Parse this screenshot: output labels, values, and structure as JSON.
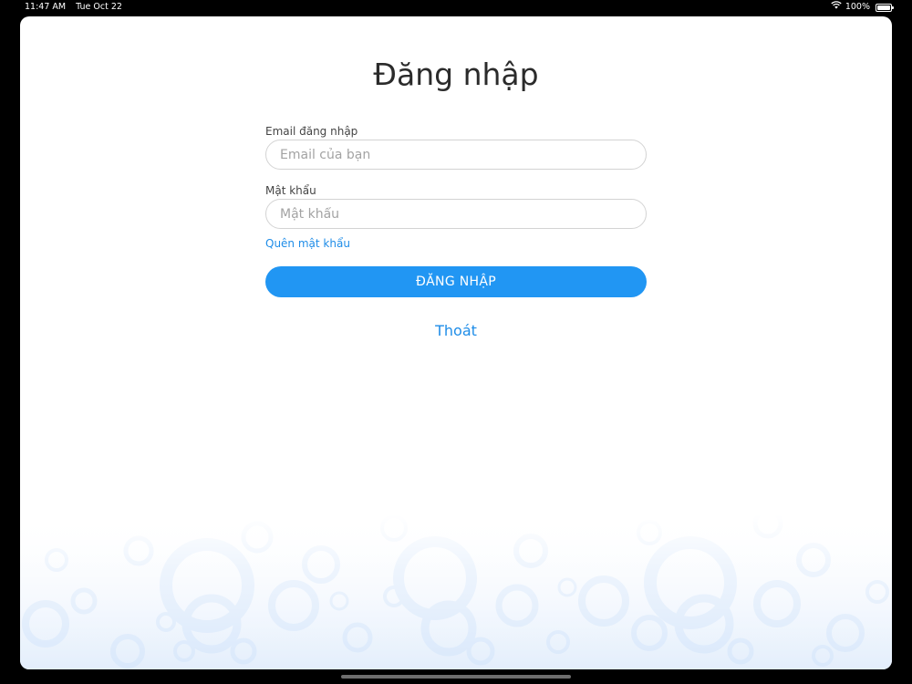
{
  "status_bar": {
    "time": "11:47 AM",
    "date": "Tue Oct 22",
    "battery": "100%",
    "battery_level": 1.0
  },
  "login": {
    "title": "Đăng nhập",
    "email_label": "Email đăng nhập",
    "email_placeholder": "Email của bạn",
    "email_value": "",
    "password_label": "Mật khẩu",
    "password_placeholder": "Mật khẩu",
    "password_value": "",
    "forgot_password": "Quên mật khẩu",
    "login_button": "ĐĂNG NHẬP",
    "exit_link": "Thoát"
  },
  "colors": {
    "accent": "#2196f3",
    "link": "#1f8de8",
    "pattern": "#d9e8fb"
  },
  "icons": [
    "wifi-icon",
    "battery-icon"
  ]
}
